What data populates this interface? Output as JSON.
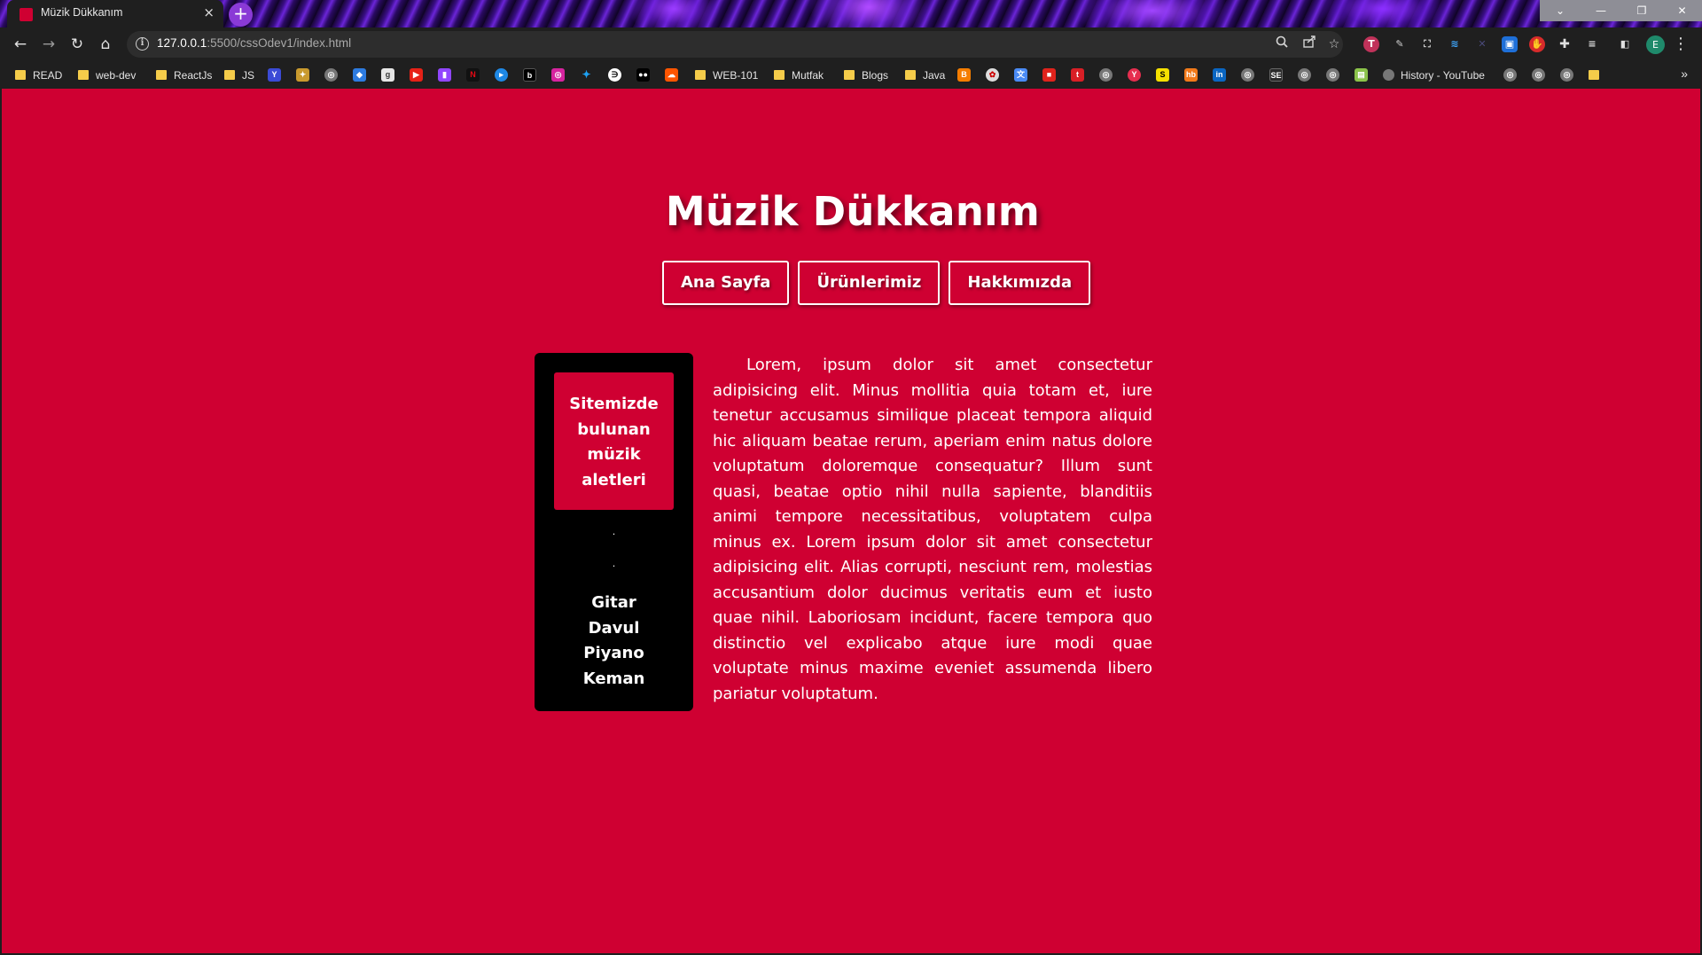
{
  "browser": {
    "tab_title": "Müzik Dükkanım",
    "tab_close": "×",
    "new_tab": "+",
    "url_host": "127.0.0.1",
    "url_path": ":5500/cssOdev1/index.html",
    "window_controls": {
      "tab_search": "⌄",
      "minimize": "—",
      "restore": "❐",
      "close": "✕"
    },
    "nav_icons": {
      "back": "←",
      "forward": "→",
      "reload": "↻",
      "home": "⌂"
    },
    "omnibox_icons": [
      "zoom-icon",
      "share-icon",
      "star-icon"
    ],
    "profile_initial": "E",
    "menu": "⋮",
    "bookmarks": [
      {
        "label": "READ",
        "type": "folder"
      },
      {
        "label": "web-dev",
        "type": "folder"
      },
      {
        "label": "ReactJs",
        "type": "folder"
      },
      {
        "label": "JS",
        "type": "folder"
      },
      {
        "label": "WEB-101",
        "type": "folder"
      },
      {
        "label": "Mutfak",
        "type": "folder"
      },
      {
        "label": "Blogs",
        "type": "folder"
      },
      {
        "label": "Java",
        "type": "folder"
      },
      {
        "label": "History - YouTube",
        "type": "link"
      }
    ],
    "bookmarks_overflow": "»"
  },
  "page": {
    "title": "Müzik Dükkanım",
    "nav": [
      {
        "label": "Ana Sayfa"
      },
      {
        "label": "Ürünlerimiz"
      },
      {
        "label": "Hakkımızda"
      }
    ],
    "sidebar": {
      "box_text": "Sitemizde bulunan müzik aletleri",
      "dot": ".",
      "instruments": [
        "Gitar",
        "Davul",
        "Piyano",
        "Keman"
      ]
    },
    "article": "Lorem, ipsum dolor sit amet consectetur adipisicing elit. Minus mollitia quia totam et, iure tenetur accusamus similique placeat tempora aliquid hic aliquam beatae rerum, aperiam enim natus dolore voluptatum doloremque consequatur? Illum sunt quasi, beatae optio nihil nulla sapiente, blanditiis animi tempore necessitatibus, voluptatem culpa minus ex. Lorem ipsum dolor sit amet consectetur adipisicing elit. Alias corrupti, nesciunt rem, molestias accusantium dolor ducimus veritatis eum et iusto quae nihil. Laboriosam incidunt, facere tempora quo distinctio vel explicabo atque iure modi quae voluptate minus maxime eveniet assumenda libero pariatur voluptatum."
  },
  "colors": {
    "page_bg": "#cf0032",
    "sidebar_bg": "#000000",
    "text": "#ffffff",
    "chrome_bg": "#1f1f1f",
    "folder": "#f5cc4a"
  }
}
